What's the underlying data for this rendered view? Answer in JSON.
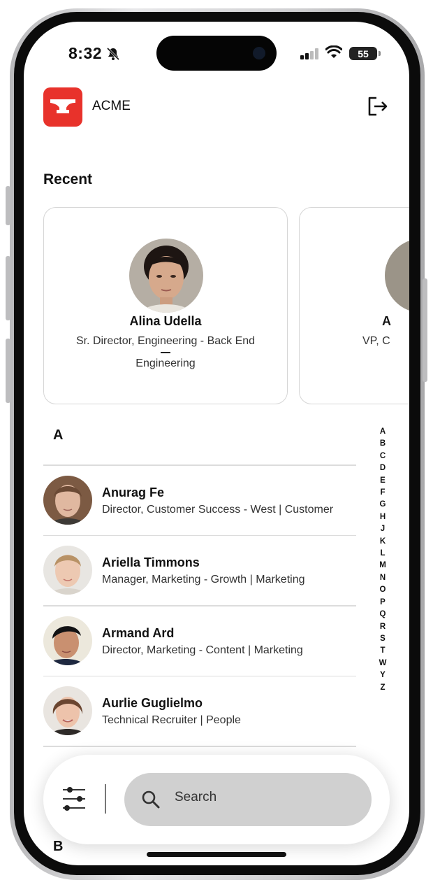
{
  "status": {
    "time": "8:32",
    "battery": "55"
  },
  "header": {
    "brand": "ACME"
  },
  "recent": {
    "title": "Recent",
    "cards": [
      {
        "name": "Alina Udella",
        "role": "Sr. Director, Engineering - Back End",
        "department": "Engineering"
      },
      {
        "name": "A",
        "role": "VP, C"
      }
    ]
  },
  "directory": {
    "section_a": "A",
    "section_b": "B",
    "people": [
      {
        "name": "Anurag Fe",
        "meta": "Director, Customer Success - West  |  Customer"
      },
      {
        "name": "Ariella Timmons",
        "meta": "Manager, Marketing - Growth  |  Marketing"
      },
      {
        "name": "Armand Ard",
        "meta": "Director, Marketing - Content  |  Marketing"
      },
      {
        "name": "Aurlie Guglielmo",
        "meta": "Technical Recruiter  |  People"
      }
    ],
    "alphabet": [
      "A",
      "B",
      "C",
      "D",
      "E",
      "F",
      "G",
      "H",
      "J",
      "K",
      "L",
      "M",
      "N",
      "O",
      "P",
      "Q",
      "R",
      "S",
      "T",
      "W",
      "Y",
      "Z"
    ]
  },
  "search": {
    "placeholder": "Search"
  },
  "icons": {
    "logo": "anvil-icon",
    "logout": "logout-icon",
    "filter": "sliders-icon",
    "search": "search-icon"
  },
  "colors": {
    "brand_red": "#e8322b",
    "search_bg": "#d0d0d0"
  }
}
